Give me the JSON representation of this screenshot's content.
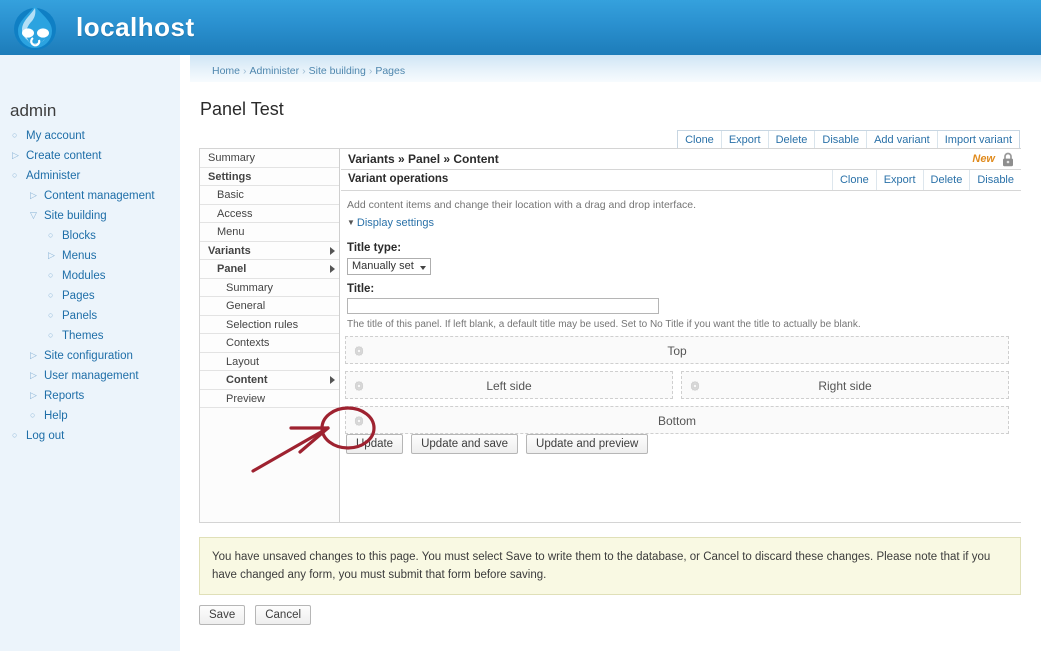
{
  "header": {
    "site_name": "localhost",
    "logo_icon": "drupal-droplet-icon",
    "bg_color": "#2a90cf"
  },
  "sidebar": {
    "user": "admin",
    "items": [
      {
        "label": "My account",
        "level": 0,
        "marker": "circle"
      },
      {
        "label": "Create content",
        "level": 0,
        "marker": "triangle-right"
      },
      {
        "label": "Administer",
        "level": 0,
        "marker": "circle"
      },
      {
        "label": "Content management",
        "level": 1,
        "marker": "triangle-right"
      },
      {
        "label": "Site building",
        "level": 1,
        "marker": "triangle-down"
      },
      {
        "label": "Blocks",
        "level": 2,
        "marker": "circle"
      },
      {
        "label": "Menus",
        "level": 2,
        "marker": "triangle-right"
      },
      {
        "label": "Modules",
        "level": 2,
        "marker": "circle"
      },
      {
        "label": "Pages",
        "level": 2,
        "marker": "circle"
      },
      {
        "label": "Panels",
        "level": 2,
        "marker": "circle"
      },
      {
        "label": "Themes",
        "level": 2,
        "marker": "circle"
      },
      {
        "label": "Site configuration",
        "level": 1,
        "marker": "triangle-right"
      },
      {
        "label": "User management",
        "level": 1,
        "marker": "triangle-right"
      },
      {
        "label": "Reports",
        "level": 1,
        "marker": "triangle-right"
      },
      {
        "label": "Help",
        "level": 1,
        "marker": "circle"
      },
      {
        "label": "Log out",
        "level": 0,
        "marker": "circle"
      }
    ]
  },
  "breadcrumb": [
    "Home",
    "Administer",
    "Site building",
    "Pages"
  ],
  "page_title": "Panel Test",
  "top_operations": [
    "Clone",
    "Export",
    "Delete",
    "Disable",
    "Add variant",
    "Import variant"
  ],
  "tab_column": [
    {
      "label": "Summary",
      "style": "d0b",
      "arrow": false
    },
    {
      "label": "Settings",
      "style": "d0",
      "arrow": false
    },
    {
      "label": "Basic",
      "style": "d1",
      "arrow": false
    },
    {
      "label": "Access",
      "style": "d1",
      "arrow": false
    },
    {
      "label": "Menu",
      "style": "d1",
      "arrow": false
    },
    {
      "label": "Variants",
      "style": "d0",
      "arrow": true
    },
    {
      "label": "Panel",
      "style": "d1b",
      "arrow": true
    },
    {
      "label": "Summary",
      "style": "d2",
      "arrow": false
    },
    {
      "label": "General",
      "style": "d2",
      "arrow": false
    },
    {
      "label": "Selection rules",
      "style": "d2",
      "arrow": false
    },
    {
      "label": "Contexts",
      "style": "d2",
      "arrow": false
    },
    {
      "label": "Layout",
      "style": "d2",
      "arrow": false
    },
    {
      "label": "Content",
      "style": "d2b",
      "arrow": true
    },
    {
      "label": "Preview",
      "style": "d2",
      "arrow": false
    }
  ],
  "content": {
    "title": "Variants » Panel » Content",
    "new_badge": "New",
    "lock_icon": "padlock-icon",
    "operations_label": "Variant operations",
    "operations": [
      "Clone",
      "Export",
      "Delete",
      "Disable"
    ],
    "description": "Add content items and change their location with a drag and drop interface.",
    "display_settings_label": "Display settings",
    "title_type_label": "Title type:",
    "title_type_value": "Manually set",
    "title_label": "Title:",
    "title_value": "",
    "title_help": "The title of this panel. If left blank, a default title may be used. Set to No Title if you want the title to actually be blank.",
    "regions": {
      "top": "Top",
      "left": "Left side",
      "right": "Right side",
      "bottom": "Bottom"
    },
    "gear_icon": "gear-icon",
    "update_buttons": [
      "Update",
      "Update and save",
      "Update and preview"
    ]
  },
  "warning_message": "You have unsaved changes to this page. You must select Save to write them to the database, or Cancel to discard these changes. Please note that if you have changed any form, you must submit that form before saving.",
  "save_buttons": [
    "Save",
    "Cancel"
  ],
  "annotation": {
    "type": "arrow-and-circle",
    "color": "#9e2230",
    "target": "bottom-region-gear-icon"
  }
}
